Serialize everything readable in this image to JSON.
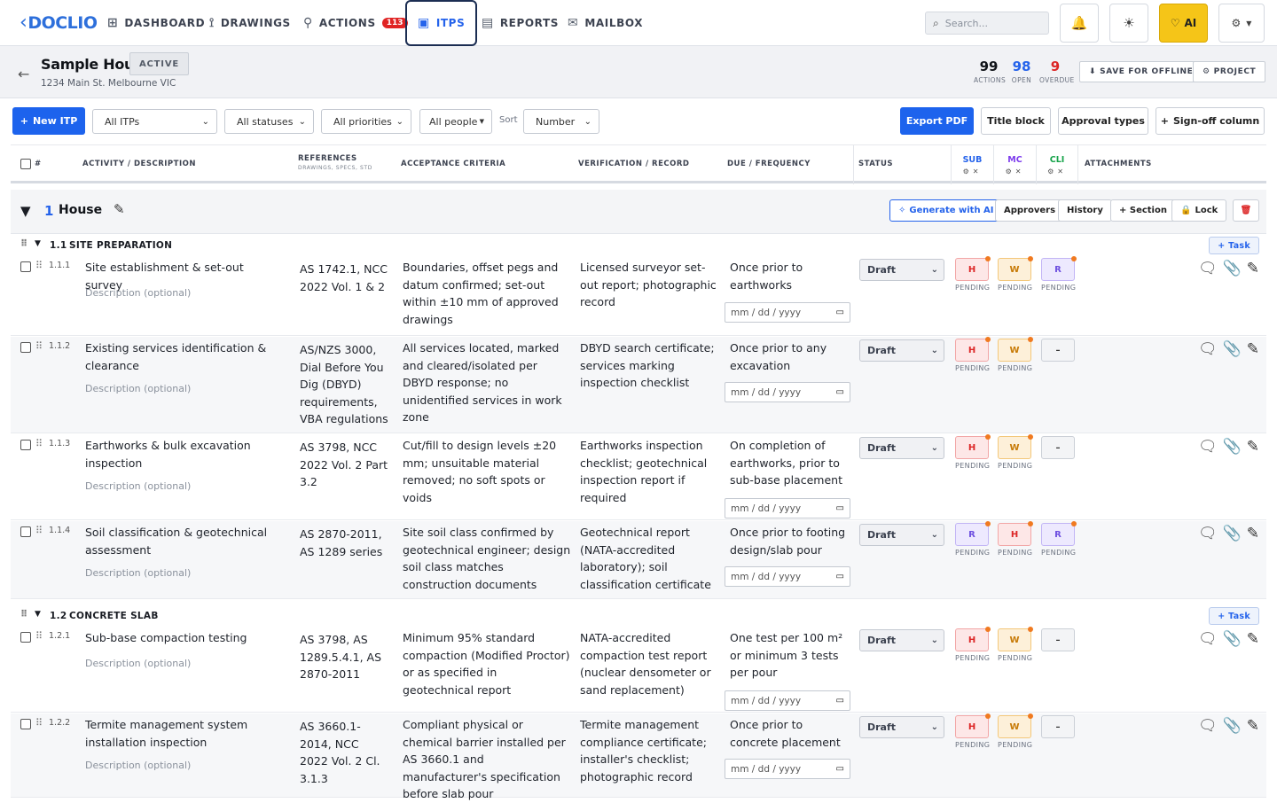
{
  "nav": {
    "logo": "DOCLIO",
    "items": [
      {
        "label": "DASHBOARD"
      },
      {
        "label": "DRAWINGS"
      },
      {
        "label": "ACTIONS",
        "badge": "113"
      },
      {
        "label": "ITPS"
      },
      {
        "label": "REPORTS"
      },
      {
        "label": "MAILBOX"
      }
    ],
    "search_placeholder": "Search...",
    "ai_label": "AI"
  },
  "project": {
    "title": "Sample House",
    "status": "ACTIVE",
    "address": "1234 Main St. Melbourne VIC",
    "stats": [
      {
        "value": "99",
        "label": "ACTIONS",
        "color": "#101318"
      },
      {
        "value": "98",
        "label": "OPEN",
        "color": "#2563eb"
      },
      {
        "value": "9",
        "label": "OVERDUE",
        "color": "#dc2626"
      }
    ],
    "save_offline": "SAVE FOR OFFLINE",
    "project_btn": "PROJECT"
  },
  "toolbar": {
    "new_itp": "New ITP",
    "filters": {
      "itps": "All ITPs",
      "statuses": "All statuses",
      "priorities": "All priorities",
      "people": "All people"
    },
    "sort_label": "Sort",
    "sort_value": "Number",
    "export_pdf": "Export PDF",
    "title_block": "Title block",
    "approval_types": "Approval types",
    "signoff_column": "Sign-off column"
  },
  "table_header": {
    "num": "#",
    "activity": "ACTIVITY / DESCRIPTION",
    "references": "REFERENCES",
    "references_sub": "DRAWINGS, SPECS, STD",
    "acceptance": "ACCEPTANCE CRITERIA",
    "verification": "VERIFICATION / RECORD",
    "due": "DUE / FREQUENCY",
    "status": "STATUS",
    "signoffs": [
      {
        "label": "SUB",
        "color": "#2563eb"
      },
      {
        "label": "MC",
        "color": "#7c3aed"
      },
      {
        "label": "CLI",
        "color": "#16a34a"
      }
    ],
    "attachments": "ATTACHMENTS"
  },
  "section": {
    "number": "1",
    "title": "House",
    "generate_ai": "Generate with AI",
    "approvers": "Approvers",
    "history": "History",
    "add_section": "+ Section",
    "lock": "Lock"
  },
  "subsections": [
    {
      "number": "1.1",
      "title": "SITE PREPARATION",
      "task_btn": "+ Task"
    },
    {
      "number": "1.2",
      "title": "CONCRETE SLAB",
      "task_btn": "+ Task"
    }
  ],
  "common": {
    "desc_placeholder": "Description (optional)",
    "date_placeholder": "mm / dd / yyyy",
    "status_value": "Draft",
    "pending": "PENDING"
  },
  "rows": [
    {
      "num": "1.1.1",
      "activity": "Site establishment & set-out survey",
      "references": "AS 1742.1, NCC 2022 Vol. 1 & 2",
      "acceptance": "Boundaries, offset pegs and datum confirmed; set-out within ±10 mm of approved drawings",
      "verification": "Licensed surveyor set-out report; photographic record",
      "due": "Once prior to earthworks",
      "signoffs": [
        "H",
        "W",
        "R"
      ]
    },
    {
      "num": "1.1.2",
      "activity": "Existing services identification & clearance",
      "references": "AS/NZS 3000, Dial Before You Dig (DBYD) requirements, VBA regulations",
      "acceptance": "All services located, marked and cleared/isolated per DBYD response; no unidentified services in work zone",
      "verification": "DBYD search certificate; services marking inspection checklist",
      "due": "Once prior to any excavation",
      "signoffs": [
        "H",
        "W",
        "–"
      ]
    },
    {
      "num": "1.1.3",
      "activity": "Earthworks & bulk excavation inspection",
      "references": "AS 3798, NCC 2022 Vol. 2 Part 3.2",
      "acceptance": "Cut/fill to design levels ±20 mm; unsuitable material removed; no soft spots or voids",
      "verification": "Earthworks inspection checklist; geotechnical inspection report if required",
      "due": "On completion of earthworks, prior to sub-base placement",
      "signoffs": [
        "H",
        "W",
        "–"
      ]
    },
    {
      "num": "1.1.4",
      "activity": "Soil classification & geotechnical assessment",
      "references": "AS 2870-2011, AS 1289 series",
      "acceptance": "Site soil class confirmed by geotechnical engineer; design soil class matches construction documents",
      "verification": "Geotechnical report (NATA-accredited laboratory); soil classification certificate",
      "due": "Once prior to footing design/slab pour",
      "signoffs": [
        "R",
        "H",
        "R"
      ]
    },
    {
      "num": "1.2.1",
      "activity": "Sub-base compaction testing",
      "references": "AS 3798, AS 1289.5.4.1, AS 2870-2011",
      "acceptance": "Minimum 95% standard compaction (Modified Proctor) or as specified in geotechnical report",
      "verification": "NATA-accredited compaction test report (nuclear densometer or sand replacement)",
      "due": "One test per 100 m² or minimum 3 tests per pour",
      "signoffs": [
        "H",
        "W",
        "–"
      ]
    },
    {
      "num": "1.2.2",
      "activity": "Termite management system installation inspection",
      "references": "AS 3660.1-2014, NCC 2022 Vol. 2 Cl. 3.1.3",
      "acceptance": "Compliant physical or chemical barrier installed per AS 3660.1 and manufacturer's specification before slab pour",
      "verification": "Termite management compliance certificate; installer's checklist; photographic record",
      "due": "Once prior to concrete placement",
      "signoffs": [
        "H",
        "W",
        "–"
      ]
    }
  ]
}
